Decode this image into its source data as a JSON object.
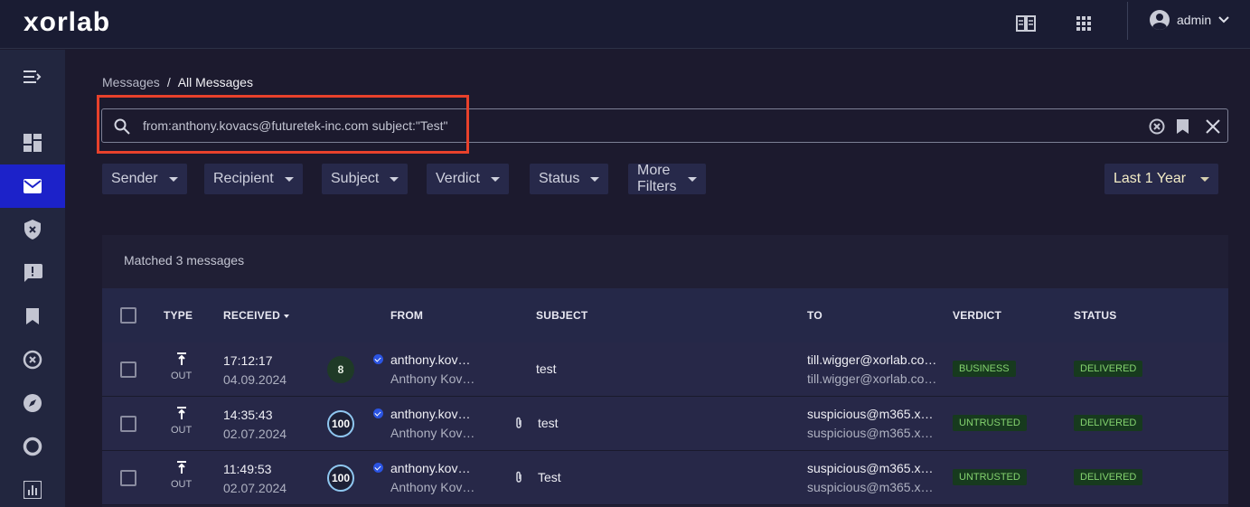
{
  "app": {
    "logo": "xorlab"
  },
  "header": {
    "user_label": "admin"
  },
  "breadcrumb": {
    "parent": "Messages",
    "separator": "/",
    "current": "All Messages"
  },
  "search": {
    "query": "from:anthony.kovacs@futuretek-inc.com subject:\"Test\""
  },
  "filters": [
    "Sender",
    "Recipient",
    "Subject",
    "Verdict",
    "Status",
    "More Filters"
  ],
  "time_range": "Last 1 Year",
  "results": {
    "matched_label": "Matched 3 messages"
  },
  "table": {
    "headers": {
      "type": "TYPE",
      "received": "RECEIVED",
      "from": "FROM",
      "subject": "SUBJECT",
      "to": "TO",
      "verdict": "VERDICT",
      "status": "STATUS"
    },
    "rows": [
      {
        "type": "OUT",
        "time": "17:12:17",
        "date": "04.09.2024",
        "score": "8",
        "from_email": "anthony.kov…",
        "from_name": "Anthony Kov…",
        "subject": "test",
        "attachment": false,
        "to_email": "till.wigger@xorlab.co…",
        "to_name": "till.wigger@xorlab.co…",
        "verdict": "BUSINESS",
        "status": "DELIVERED"
      },
      {
        "type": "OUT",
        "time": "14:35:43",
        "date": "02.07.2024",
        "score": "100",
        "from_email": "anthony.kov…",
        "from_name": "Anthony Kov…",
        "subject": "test",
        "attachment": true,
        "to_email": "suspicious@m365.x…",
        "to_name": "suspicious@m365.x…",
        "verdict": "UNTRUSTED",
        "status": "DELIVERED"
      },
      {
        "type": "OUT",
        "time": "11:49:53",
        "date": "02.07.2024",
        "score": "100",
        "from_email": "anthony.kov…",
        "from_name": "Anthony Kov…",
        "subject": "Test",
        "attachment": true,
        "to_email": "suspicious@m365.x…",
        "to_name": "suspicious@m365.x…",
        "verdict": "UNTRUSTED",
        "status": "DELIVERED"
      }
    ]
  },
  "colors": {
    "accent": "#1c22c9",
    "highlight": "#e8412b",
    "badge_text": "#84d36f",
    "badge_bg": "#173a1e"
  },
  "icons": {
    "top": [
      "book-icon",
      "apps-grid-icon"
    ],
    "sidebar": [
      "menu-collapse-icon",
      "dashboard-icon",
      "mail-icon",
      "shield-icon",
      "report-icon",
      "bookmark-icon",
      "target-icon",
      "compass-icon",
      "ring-icon",
      "chart-icon"
    ]
  }
}
